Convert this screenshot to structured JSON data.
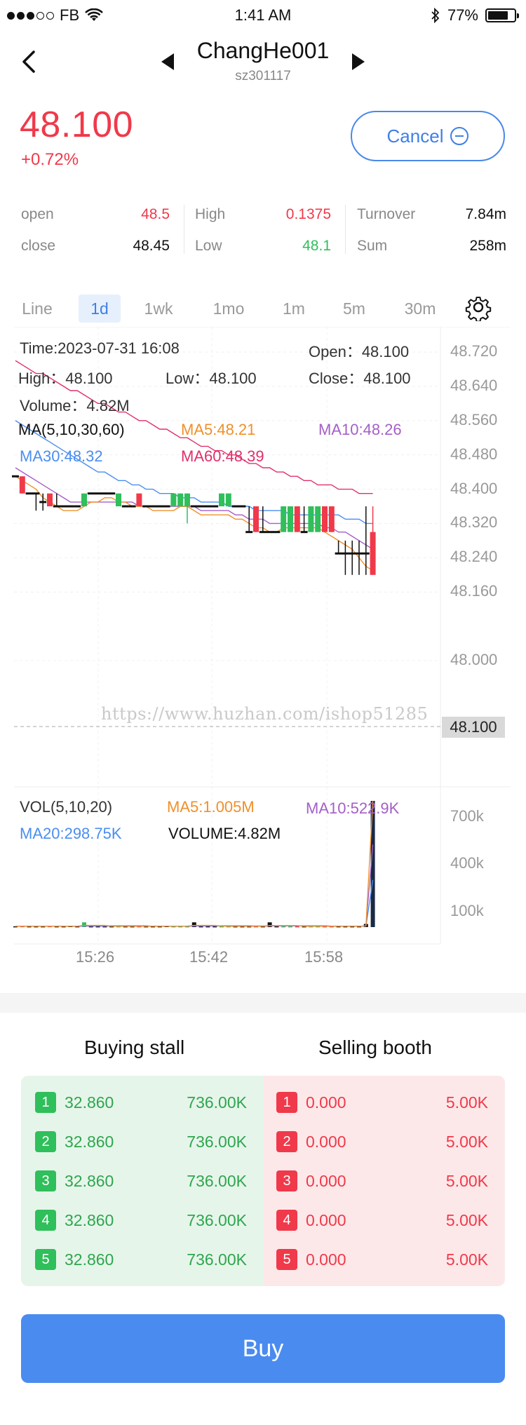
{
  "status_bar": {
    "carrier": "FB",
    "time": "1:41 AM",
    "battery": "77%",
    "battery_level": 0.77
  },
  "header": {
    "title": "ChangHe001",
    "code": "sz301117"
  },
  "quote": {
    "price": "48.100",
    "change_pct": "+0.72%",
    "cancel_label": "Cancel"
  },
  "stats": [
    {
      "label": "open",
      "value": "48.5",
      "color": "#f0394a"
    },
    {
      "label": "close",
      "value": "48.45",
      "color": "#111111"
    },
    {
      "label": "High",
      "value": "0.1375",
      "color": "#f0394a"
    },
    {
      "label": "Low",
      "value": "48.1",
      "color": "#2fbf5b"
    },
    {
      "label": "Turnover",
      "value": "7.84m",
      "color": "#111111"
    },
    {
      "label": "Sum",
      "value": "258m",
      "color": "#111111"
    }
  ],
  "tabs": [
    {
      "label": "Line",
      "active": false
    },
    {
      "label": "1d",
      "active": true
    },
    {
      "label": "1wk",
      "active": false
    },
    {
      "label": "1mo",
      "active": false
    },
    {
      "label": "1m",
      "active": false
    },
    {
      "label": "5m",
      "active": false
    },
    {
      "label": "30m",
      "active": false
    }
  ],
  "candle_info": {
    "time": "Time:2023-07-31 16:08",
    "open": "Open：48.100",
    "high": "High：48.100",
    "low": "Low：48.100",
    "close": "Close：48.100",
    "volume": "Volume：4.82M"
  },
  "ma_info": {
    "label": "MA(5,10,30,60)",
    "ma5": "MA5:48.21",
    "ma10": "MA10:48.26",
    "ma30": "MA30:48.32",
    "ma60": "MA60:48.39"
  },
  "vol_info": {
    "label": "VOL(5,10,20)",
    "ma5": "MA5:1.005M",
    "ma10": "MA10:522.9K",
    "ma20": "MA20:298.75K",
    "volume": "VOLUME:4.82M"
  },
  "colors": {
    "up": "#f0394a",
    "down": "#2fbf5b",
    "accent": "#3f7fe6",
    "ma5": "#f0902a",
    "ma10": "#a45fc7",
    "ma30": "#4a8ef0",
    "ma60": "#e0306a"
  },
  "watermark": "https://www.huzhan.com/ishop51285",
  "last_price_tag": "48.100",
  "chart_data": [
    {
      "type": "candlestick",
      "y_ticks": [
        "48.720",
        "48.640",
        "48.560",
        "48.480",
        "48.400",
        "48.320",
        "48.240",
        "48.160",
        "48.000"
      ],
      "ylim": [
        48.0,
        48.72
      ],
      "last_price": 48.1,
      "candles": [
        {
          "o": 48.43,
          "c": 48.43,
          "h": 48.43,
          "l": 48.43
        },
        {
          "o": 48.43,
          "c": 48.39,
          "h": 48.43,
          "l": 48.39
        },
        {
          "o": 48.39,
          "c": 48.39,
          "h": 48.39,
          "l": 48.39
        },
        {
          "o": 48.39,
          "c": 48.39,
          "h": 48.39,
          "l": 48.35
        },
        {
          "o": 48.37,
          "c": 48.37,
          "h": 48.39,
          "l": 48.35
        },
        {
          "o": 48.39,
          "c": 48.36,
          "h": 48.39,
          "l": 48.36
        },
        {
          "o": 48.36,
          "c": 48.36,
          "h": 48.39,
          "l": 48.36
        },
        {
          "o": 48.36,
          "c": 48.36,
          "h": 48.36,
          "l": 48.36
        },
        {
          "o": 48.36,
          "c": 48.36,
          "h": 48.36,
          "l": 48.36
        },
        {
          "o": 48.36,
          "c": 48.36,
          "h": 48.36,
          "l": 48.36
        },
        {
          "o": 48.36,
          "c": 48.39,
          "h": 48.39,
          "l": 48.36
        },
        {
          "o": 48.39,
          "c": 48.39,
          "h": 48.39,
          "l": 48.39
        },
        {
          "o": 48.39,
          "c": 48.39,
          "h": 48.39,
          "l": 48.39
        },
        {
          "o": 48.39,
          "c": 48.39,
          "h": 48.39,
          "l": 48.39
        },
        {
          "o": 48.39,
          "c": 48.39,
          "h": 48.39,
          "l": 48.39
        },
        {
          "o": 48.36,
          "c": 48.39,
          "h": 48.39,
          "l": 48.36
        },
        {
          "o": 48.36,
          "c": 48.36,
          "h": 48.36,
          "l": 48.36
        },
        {
          "o": 48.36,
          "c": 48.36,
          "h": 48.36,
          "l": 48.36
        },
        {
          "o": 48.39,
          "c": 48.36,
          "h": 48.39,
          "l": 48.36
        },
        {
          "o": 48.36,
          "c": 48.36,
          "h": 48.36,
          "l": 48.36
        },
        {
          "o": 48.36,
          "c": 48.36,
          "h": 48.36,
          "l": 48.36
        },
        {
          "o": 48.36,
          "c": 48.36,
          "h": 48.36,
          "l": 48.36
        },
        {
          "o": 48.36,
          "c": 48.36,
          "h": 48.36,
          "l": 48.36
        },
        {
          "o": 48.36,
          "c": 48.39,
          "h": 48.39,
          "l": 48.36
        },
        {
          "o": 48.36,
          "c": 48.39,
          "h": 48.39,
          "l": 48.36
        },
        {
          "o": 48.36,
          "c": 48.39,
          "h": 48.39,
          "l": 48.32
        },
        {
          "o": 48.36,
          "c": 48.36,
          "h": 48.36,
          "l": 48.36
        },
        {
          "o": 48.36,
          "c": 48.36,
          "h": 48.36,
          "l": 48.36
        },
        {
          "o": 48.36,
          "c": 48.36,
          "h": 48.36,
          "l": 48.36
        },
        {
          "o": 48.36,
          "c": 48.36,
          "h": 48.36,
          "l": 48.36
        },
        {
          "o": 48.36,
          "c": 48.39,
          "h": 48.39,
          "l": 48.36
        },
        {
          "o": 48.36,
          "c": 48.39,
          "h": 48.39,
          "l": 48.36
        },
        {
          "o": 48.36,
          "c": 48.36,
          "h": 48.36,
          "l": 48.36
        },
        {
          "o": 48.36,
          "c": 48.36,
          "h": 48.36,
          "l": 48.36
        },
        {
          "o": 48.3,
          "c": 48.3,
          "h": 48.36,
          "l": 48.3
        },
        {
          "o": 48.36,
          "c": 48.3,
          "h": 48.36,
          "l": 48.3
        },
        {
          "o": 48.3,
          "c": 48.3,
          "h": 48.36,
          "l": 48.3
        },
        {
          "o": 48.3,
          "c": 48.3,
          "h": 48.3,
          "l": 48.3
        },
        {
          "o": 48.3,
          "c": 48.3,
          "h": 48.3,
          "l": 48.3
        },
        {
          "o": 48.3,
          "c": 48.36,
          "h": 48.36,
          "l": 48.3
        },
        {
          "o": 48.3,
          "c": 48.36,
          "h": 48.36,
          "l": 48.3
        },
        {
          "o": 48.36,
          "c": 48.3,
          "h": 48.36,
          "l": 48.3
        },
        {
          "o": 48.3,
          "c": 48.3,
          "h": 48.36,
          "l": 48.3
        },
        {
          "o": 48.3,
          "c": 48.36,
          "h": 48.36,
          "l": 48.3
        },
        {
          "o": 48.3,
          "c": 48.36,
          "h": 48.36,
          "l": 48.3
        },
        {
          "o": 48.36,
          "c": 48.3,
          "h": 48.36,
          "l": 48.3
        },
        {
          "o": 48.36,
          "c": 48.3,
          "h": 48.36,
          "l": 48.3
        },
        {
          "o": 48.25,
          "c": 48.25,
          "h": 48.28,
          "l": 48.25
        },
        {
          "o": 48.25,
          "c": 48.25,
          "h": 48.28,
          "l": 48.2
        },
        {
          "o": 48.25,
          "c": 48.25,
          "h": 48.28,
          "l": 48.2
        },
        {
          "o": 48.25,
          "c": 48.25,
          "h": 48.28,
          "l": 48.2
        },
        {
          "o": 48.25,
          "c": 48.25,
          "h": 48.36,
          "l": 48.2
        },
        {
          "o": 48.3,
          "c": 48.2,
          "h": 48.36,
          "l": 48.2
        }
      ],
      "ma5": [
        48.43,
        48.42,
        48.41,
        48.4,
        48.38,
        48.37,
        48.36,
        48.35,
        48.35,
        48.35,
        48.36,
        48.37,
        48.37,
        48.38,
        48.38,
        48.37,
        48.37,
        48.36,
        48.36,
        48.36,
        48.35,
        48.35,
        48.35,
        48.35,
        48.36,
        48.36,
        48.35,
        48.34,
        48.34,
        48.34,
        48.34,
        48.34,
        48.33,
        48.33,
        48.32,
        48.31,
        48.31,
        48.3,
        48.3,
        48.31,
        48.31,
        48.31,
        48.31,
        48.31,
        48.31,
        48.3,
        48.29,
        48.28,
        48.27,
        48.26,
        48.24,
        48.22,
        48.21
      ],
      "ma10": [
        48.45,
        48.44,
        48.43,
        48.42,
        48.41,
        48.4,
        48.39,
        48.38,
        48.37,
        48.37,
        48.37,
        48.37,
        48.37,
        48.37,
        48.37,
        48.37,
        48.37,
        48.37,
        48.36,
        48.36,
        48.36,
        48.36,
        48.36,
        48.36,
        48.36,
        48.36,
        48.36,
        48.35,
        48.35,
        48.35,
        48.35,
        48.35,
        48.34,
        48.34,
        48.33,
        48.33,
        48.33,
        48.32,
        48.32,
        48.32,
        48.32,
        48.32,
        48.32,
        48.32,
        48.32,
        48.31,
        48.31,
        48.3,
        48.3,
        48.29,
        48.28,
        48.27,
        48.26
      ],
      "ma30": [
        48.56,
        48.55,
        48.54,
        48.53,
        48.52,
        48.51,
        48.5,
        48.49,
        48.48,
        48.47,
        48.46,
        48.45,
        48.44,
        48.44,
        48.43,
        48.42,
        48.42,
        48.41,
        48.41,
        48.4,
        48.4,
        48.39,
        48.39,
        48.39,
        48.38,
        48.38,
        48.38,
        48.37,
        48.37,
        48.37,
        48.37,
        48.36,
        48.36,
        48.36,
        48.36,
        48.35,
        48.35,
        48.35,
        48.35,
        48.35,
        48.34,
        48.34,
        48.34,
        48.34,
        48.34,
        48.34,
        48.34,
        48.34,
        48.33,
        48.33,
        48.33,
        48.32,
        48.32
      ],
      "ma60": [
        48.7,
        48.69,
        48.68,
        48.67,
        48.67,
        48.66,
        48.65,
        48.64,
        48.63,
        48.63,
        48.62,
        48.61,
        48.6,
        48.6,
        48.59,
        48.58,
        48.58,
        48.57,
        48.56,
        48.56,
        48.55,
        48.54,
        48.54,
        48.53,
        48.52,
        48.52,
        48.51,
        48.5,
        48.5,
        48.49,
        48.49,
        48.48,
        48.48,
        48.47,
        48.46,
        48.46,
        48.45,
        48.45,
        48.44,
        48.44,
        48.43,
        48.43,
        48.42,
        48.42,
        48.41,
        48.41,
        48.41,
        48.4,
        48.4,
        48.4,
        48.39,
        48.39,
        48.39
      ]
    },
    {
      "type": "bar",
      "title": "VOL(5,10,20)",
      "y_ticks": [
        "700k",
        "400k",
        "100k"
      ],
      "ylim": [
        0,
        800000
      ],
      "x_ticks": [
        "15:26",
        "15:42",
        "15:58"
      ],
      "values": [
        5000,
        6000,
        5000,
        5000,
        5000,
        6000,
        5000,
        5000,
        7000,
        5000,
        30000,
        5000,
        5000,
        5000,
        5000,
        5000,
        5000,
        5000,
        5000,
        5000,
        5000,
        5000,
        8000,
        5000,
        5000,
        5000,
        30000,
        5000,
        5000,
        5000,
        5000,
        5000,
        5000,
        5000,
        5000,
        5000,
        5000,
        30000,
        5000,
        5000,
        5000,
        5000,
        5000,
        5000,
        5000,
        5000,
        5000,
        5000,
        5000,
        5000,
        5000,
        20000,
        4820000
      ],
      "ma5": [
        5000,
        5000,
        5000,
        5000,
        5000,
        5000,
        5000,
        5000,
        5000,
        6000,
        11000,
        11000,
        11000,
        11000,
        6000,
        5000,
        5000,
        5000,
        5000,
        5000,
        5000,
        5000,
        6000,
        6000,
        6000,
        6000,
        11000,
        11000,
        11000,
        11000,
        6000,
        5000,
        5000,
        5000,
        5000,
        5000,
        5000,
        10000,
        10000,
        10000,
        10000,
        10000,
        5000,
        5000,
        5000,
        5000,
        5000,
        5000,
        5000,
        5000,
        5000,
        8000,
        1005000
      ],
      "ma10": [
        5000,
        5000,
        5000,
        5000,
        5000,
        5000,
        5000,
        5000,
        5000,
        5000,
        8000,
        8000,
        8000,
        8000,
        8000,
        8000,
        8000,
        8000,
        8000,
        8000,
        5000,
        5000,
        6000,
        6000,
        6000,
        6000,
        8000,
        8000,
        8000,
        8000,
        8000,
        8000,
        8000,
        8000,
        8000,
        5000,
        5000,
        8000,
        8000,
        8000,
        8000,
        8000,
        8000,
        8000,
        8000,
        8000,
        5000,
        5000,
        5000,
        5000,
        5000,
        7000,
        522900
      ],
      "ma20": [
        5000,
        5000,
        5000,
        5000,
        5000,
        5000,
        5000,
        5000,
        5000,
        5000,
        6000,
        6000,
        6000,
        6000,
        6000,
        6000,
        6000,
        6000,
        6000,
        6000,
        6000,
        6000,
        6000,
        6000,
        6000,
        6000,
        7000,
        7000,
        7000,
        7000,
        7000,
        7000,
        7000,
        7000,
        7000,
        7000,
        7000,
        8000,
        8000,
        8000,
        8000,
        8000,
        8000,
        8000,
        8000,
        8000,
        6000,
        6000,
        6000,
        6000,
        6000,
        6000,
        298750
      ]
    }
  ],
  "order_book": {
    "buy_title": "Buying stall",
    "sell_title": "Selling booth",
    "buy": [
      {
        "rank": "1",
        "price": "32.860",
        "volume": "736.00K"
      },
      {
        "rank": "2",
        "price": "32.860",
        "volume": "736.00K"
      },
      {
        "rank": "3",
        "price": "32.860",
        "volume": "736.00K"
      },
      {
        "rank": "4",
        "price": "32.860",
        "volume": "736.00K"
      },
      {
        "rank": "5",
        "price": "32.860",
        "volume": "736.00K"
      }
    ],
    "sell": [
      {
        "rank": "1",
        "price": "0.000",
        "volume": "5.00K"
      },
      {
        "rank": "2",
        "price": "0.000",
        "volume": "5.00K"
      },
      {
        "rank": "3",
        "price": "0.000",
        "volume": "5.00K"
      },
      {
        "rank": "4",
        "price": "0.000",
        "volume": "5.00K"
      },
      {
        "rank": "5",
        "price": "0.000",
        "volume": "5.00K"
      }
    ]
  },
  "buy_button": "Buy"
}
